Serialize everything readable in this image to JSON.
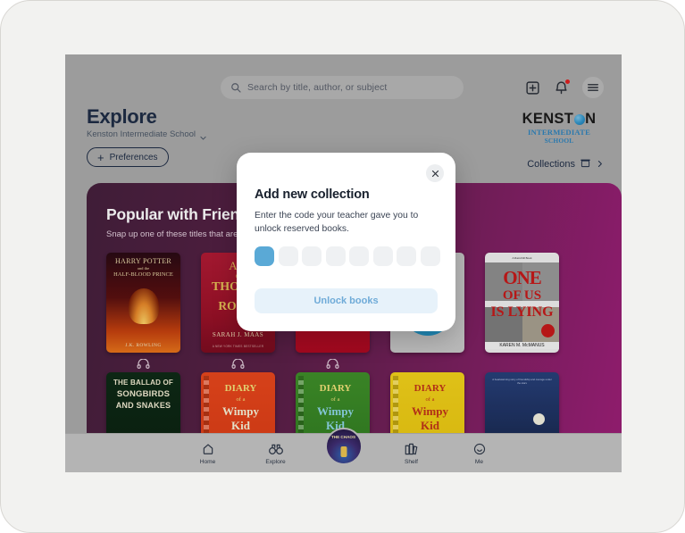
{
  "search": {
    "placeholder": "Search by title, author, or subject",
    "icon": "search-icon"
  },
  "topbar": {
    "add_icon": "plus-square-icon",
    "notifications_icon": "bell-icon",
    "menu_icon": "hamburger-menu-icon"
  },
  "header": {
    "title": "Explore",
    "school": "Kenston Intermediate School",
    "school_chevron": "chevron-down-icon",
    "preferences_label": "Preferences",
    "preferences_plus": "+"
  },
  "logo": {
    "main_left": "KENST",
    "main_right": "N",
    "sub1": "INTERMEDIATE",
    "sub2": "SCHOOL",
    "accent": "#2f84bd"
  },
  "collections": {
    "label": "Collections",
    "box_icon": "archive-box-icon",
    "chevron": "chevron-right-icon"
  },
  "card": {
    "title": "Popular with Friends",
    "subtitle": "Snap up one of these titles that are",
    "gradient_from": "#45203c",
    "gradient_to": "#9c1f77"
  },
  "books_row1": [
    {
      "title_lines": [
        "HARRY POTTER",
        "and the",
        "HALF-BLOOD PRINCE"
      ],
      "author": "J.K. ROWLING",
      "audio": true,
      "style": "c-hp"
    },
    {
      "title_lines": [
        "A C",
        "of",
        "THORNS",
        "ROSES"
      ],
      "author": "SARAH J. MAAS",
      "note": "A NEW YORK TIMES BESTSELLER",
      "audio": true,
      "style": "c-acotar"
    },
    {
      "title_lines": [],
      "audio": true,
      "style": "c-red"
    },
    {
      "title_lines": [],
      "audio": false,
      "style": "c-gray"
    },
    {
      "title_lines": [
        "ONE",
        "OF US",
        "IS LYING"
      ],
      "author": "KAREN M. McMANUS",
      "audio": false,
      "style": "c-ouil"
    }
  ],
  "books_row2": [
    {
      "title_lines": [
        "THE BALLAD OF",
        "SONGBIRDS",
        "AND SNAKES"
      ],
      "style": "c-ballad"
    },
    {
      "title_lines": [
        "DIARY",
        "of a",
        "Wimpy Kid"
      ],
      "style": "c-wk1"
    },
    {
      "title_lines": [
        "DIARY",
        "of a",
        "Wimpy Kid"
      ],
      "style": "c-wk2"
    },
    {
      "title_lines": [
        "DIARY",
        "of a",
        "Wimpy Kid"
      ],
      "style": "c-wk3"
    },
    {
      "title_lines": [],
      "style": "c-night"
    }
  ],
  "modal": {
    "title": "Add new collection",
    "description": "Enter the code your teacher gave you to unlock reserved books.",
    "close_icon": "close-icon",
    "code_length": 8,
    "active_index": 0,
    "active_color": "#5aa9d6",
    "button_label": "Unlock books",
    "button_bg": "#e7f2fa",
    "button_text_color": "#6fabd8"
  },
  "bottom_nav": [
    {
      "label": "Home",
      "icon": "home-icon"
    },
    {
      "label": "Explore",
      "icon": "binoculars-icon"
    },
    {
      "label": "",
      "icon": "current-book-icon"
    },
    {
      "label": "Shelf",
      "icon": "bookshelf-icon"
    },
    {
      "label": "Me",
      "icon": "smiley-face-icon"
    }
  ]
}
